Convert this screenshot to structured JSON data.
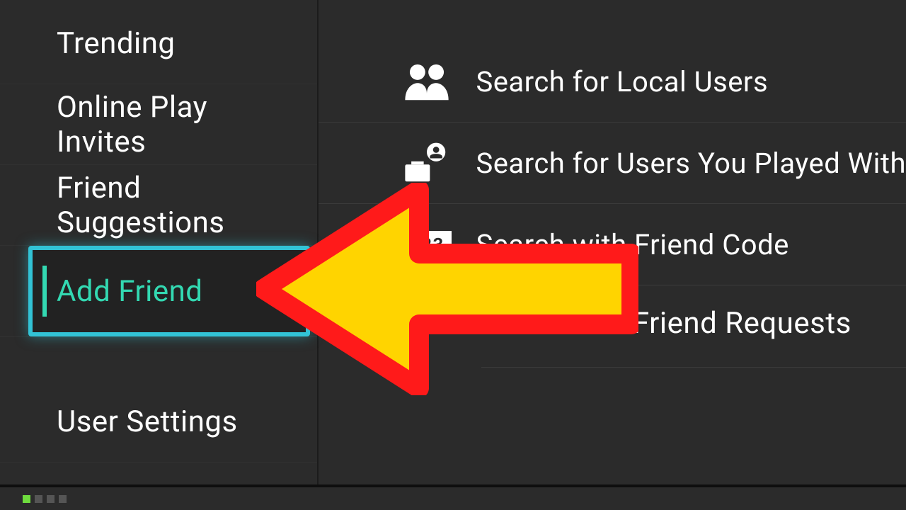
{
  "sidebar": {
    "items": [
      {
        "label": "Trending"
      },
      {
        "label": "Online Play Invites"
      },
      {
        "label": "Friend Suggestions"
      },
      {
        "label": "Add Friend"
      },
      {
        "label": "User Settings"
      }
    ]
  },
  "content": {
    "options": [
      {
        "label": "Search for Local Users"
      },
      {
        "label": "Search for Users You Played With"
      },
      {
        "label": "Search with Friend Code",
        "code_badge": "123"
      },
      {
        "label": "Friend Requests"
      }
    ]
  }
}
